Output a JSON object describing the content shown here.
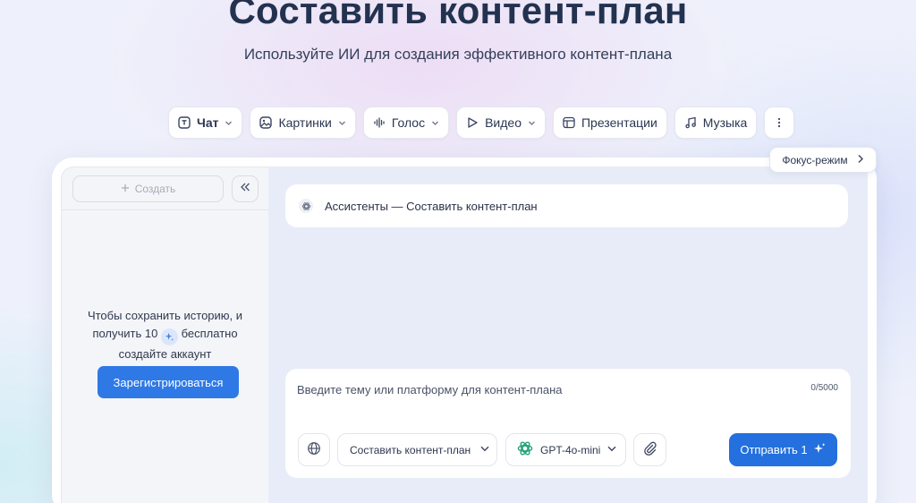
{
  "header": {
    "title": "Составить контент-план",
    "subtitle": "Используйте ИИ для создания эффективного контент-плана"
  },
  "tabs": [
    {
      "label": "Чат",
      "icon": "chat-icon",
      "has_dropdown": true,
      "active": true
    },
    {
      "label": "Картинки",
      "icon": "image-icon",
      "has_dropdown": true
    },
    {
      "label": "Голос",
      "icon": "audio-wave-icon",
      "has_dropdown": true
    },
    {
      "label": "Видео",
      "icon": "play-icon",
      "has_dropdown": true
    },
    {
      "label": "Презентации",
      "icon": "presentation-icon",
      "has_dropdown": false
    },
    {
      "label": "Музыка",
      "icon": "music-note-icon",
      "has_dropdown": false
    }
  ],
  "focus_mode": {
    "label": "Фокус-режим"
  },
  "sidebar": {
    "create_label": "Создать",
    "promo_line1": "Чтобы сохранить историю, и",
    "promo_line2_prefix": "получить 10",
    "promo_line2_suffix": "бесплатно",
    "promo_line3": "создайте аккаунт",
    "register_label": "Зарегистрироваться"
  },
  "chat": {
    "assistant_title": "Ассистенты — Составить контент-план"
  },
  "composer": {
    "placeholder": "Введите тему или платформу для контент-плана",
    "counter": "0/5000",
    "mode_label": "Составить контент-план",
    "model_label": "GPT-4o-mini",
    "send_label": "Отправить 1"
  },
  "colors": {
    "accent": "#2370de",
    "register": "#2f79e6",
    "main_bg": "#e8ecf8"
  }
}
